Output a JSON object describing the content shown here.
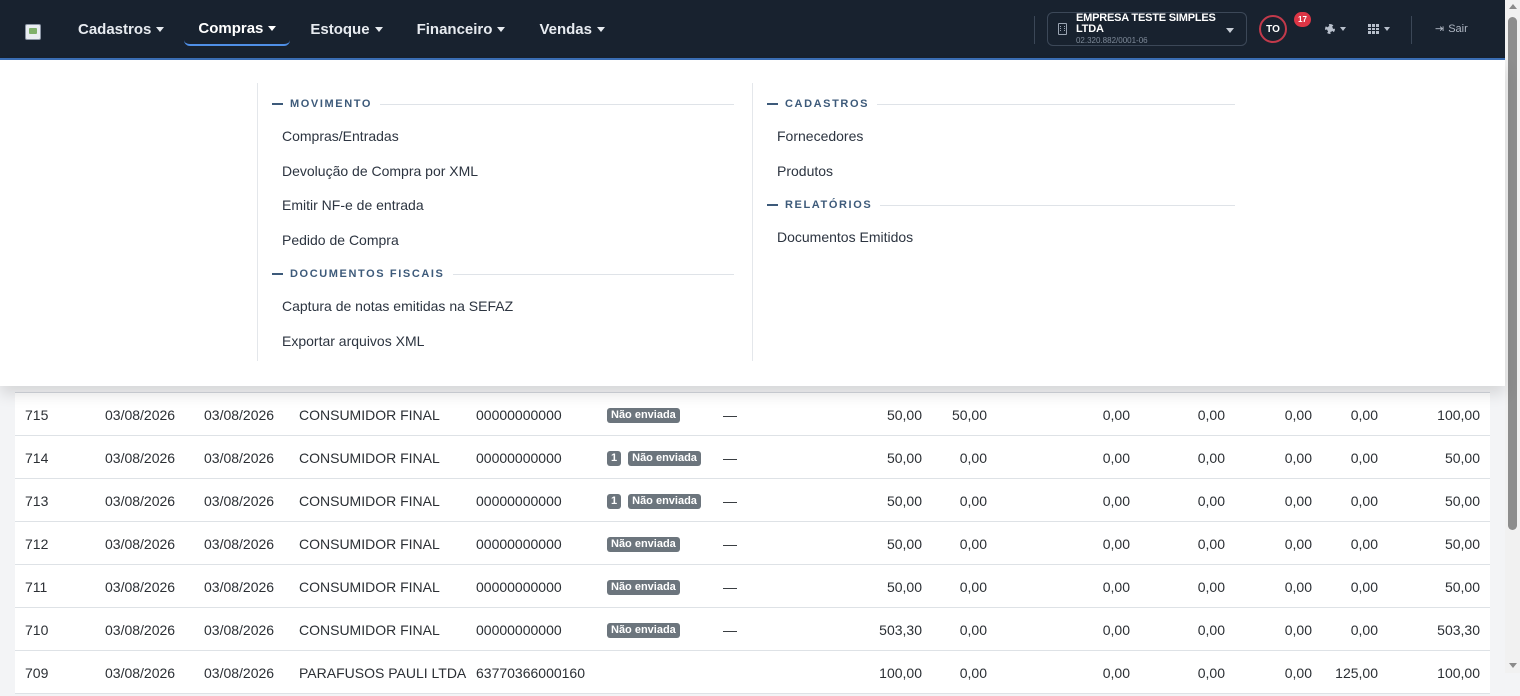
{
  "nav": {
    "items": [
      {
        "label": "Cadastros",
        "active": false
      },
      {
        "label": "Compras",
        "active": true
      },
      {
        "label": "Estoque",
        "active": false
      },
      {
        "label": "Financeiro",
        "active": false
      },
      {
        "label": "Vendas",
        "active": false
      }
    ],
    "company": {
      "name": "EMPRESA TESTE SIMPLES LTDA",
      "cnpj": "02.320.882/0001-06"
    },
    "avatar_initials": "TO",
    "notification_count": "17",
    "logout_label": "Sair",
    "icons": {
      "company": "building-icon",
      "settings": "gear-icon",
      "apps": "grid-icon",
      "logout": "sign-out-icon"
    }
  },
  "dropdown": {
    "left": [
      {
        "title": "MOVIMENTO",
        "links": [
          "Compras/Entradas",
          "Devolução de Compra por XML",
          "Emitir NF-e de entrada",
          "Pedido de Compra"
        ]
      },
      {
        "title": "DOCUMENTOS FISCAIS",
        "links": [
          "Captura de notas emitidas na SEFAZ",
          "Exportar arquivos XML"
        ]
      }
    ],
    "right": [
      {
        "title": "CADASTROS",
        "links": [
          "Fornecedores",
          "Produtos"
        ]
      },
      {
        "title": "RELATÓRIOS",
        "links": [
          "Documentos Emitidos"
        ]
      }
    ]
  },
  "table": {
    "rows": [
      {
        "id": "715",
        "date1": "03/08/2026",
        "date2": "03/08/2026",
        "client": "CONSUMIDOR FINAL",
        "doc": "00000000000",
        "count": "",
        "status": "Não enviada",
        "dash": "—",
        "v1": "50,00",
        "v2": "50,00",
        "v3": "0,00",
        "v4": "0,00",
        "v5": "0,00",
        "v6": "0,00",
        "total": "100,00"
      },
      {
        "id": "714",
        "date1": "03/08/2026",
        "date2": "03/08/2026",
        "client": "CONSUMIDOR FINAL",
        "doc": "00000000000",
        "count": "1",
        "status": "Não enviada",
        "dash": "—",
        "v1": "50,00",
        "v2": "0,00",
        "v3": "0,00",
        "v4": "0,00",
        "v5": "0,00",
        "v6": "0,00",
        "total": "50,00"
      },
      {
        "id": "713",
        "date1": "03/08/2026",
        "date2": "03/08/2026",
        "client": "CONSUMIDOR FINAL",
        "doc": "00000000000",
        "count": "1",
        "status": "Não enviada",
        "dash": "—",
        "v1": "50,00",
        "v2": "0,00",
        "v3": "0,00",
        "v4": "0,00",
        "v5": "0,00",
        "v6": "0,00",
        "total": "50,00"
      },
      {
        "id": "712",
        "date1": "03/08/2026",
        "date2": "03/08/2026",
        "client": "CONSUMIDOR FINAL",
        "doc": "00000000000",
        "count": "",
        "status": "Não enviada",
        "dash": "—",
        "v1": "50,00",
        "v2": "0,00",
        "v3": "0,00",
        "v4": "0,00",
        "v5": "0,00",
        "v6": "0,00",
        "total": "50,00"
      },
      {
        "id": "711",
        "date1": "03/08/2026",
        "date2": "03/08/2026",
        "client": "CONSUMIDOR FINAL",
        "doc": "00000000000",
        "count": "",
        "status": "Não enviada",
        "dash": "—",
        "v1": "50,00",
        "v2": "0,00",
        "v3": "0,00",
        "v4": "0,00",
        "v5": "0,00",
        "v6": "0,00",
        "total": "50,00"
      },
      {
        "id": "710",
        "date1": "03/08/2026",
        "date2": "03/08/2026",
        "client": "CONSUMIDOR FINAL",
        "doc": "00000000000",
        "count": "",
        "status": "Não enviada",
        "dash": "—",
        "v1": "503,30",
        "v2": "0,00",
        "v3": "0,00",
        "v4": "0,00",
        "v5": "0,00",
        "v6": "0,00",
        "total": "503,30"
      },
      {
        "id": "709",
        "date1": "03/08/2026",
        "date2": "03/08/2026",
        "client": "PARAFUSOS PAULI LTDA",
        "doc": "63770366000160",
        "count": "",
        "status": "",
        "dash": "",
        "v1": "100,00",
        "v2": "0,00",
        "v3": "0,00",
        "v4": "0,00",
        "v5": "0,00",
        "v6": "125,00",
        "total": "100,00"
      }
    ]
  }
}
